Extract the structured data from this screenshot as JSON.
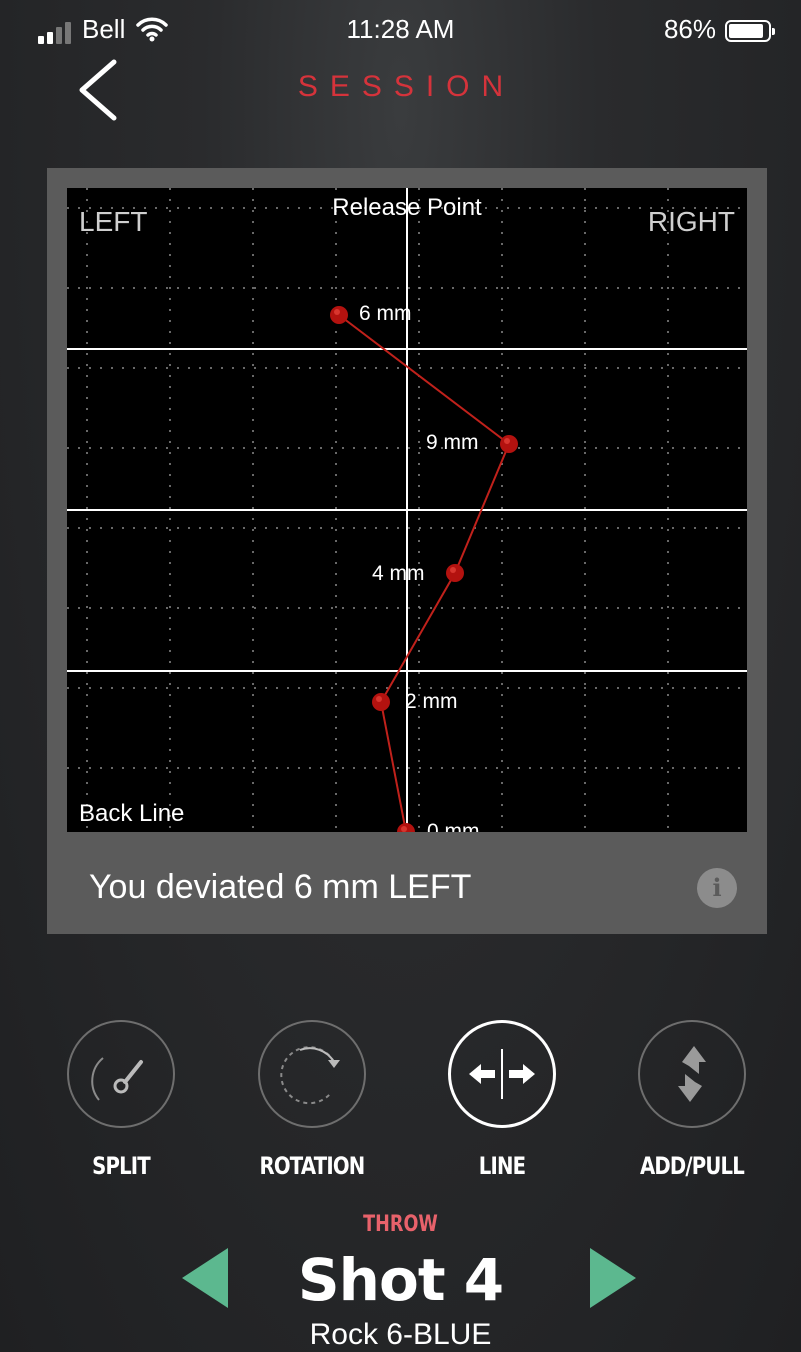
{
  "status_bar": {
    "carrier": "Bell",
    "time": "11:28 AM",
    "battery": "86%"
  },
  "header": {
    "title": "SESSION",
    "back_icon": "chevron-left-icon"
  },
  "plot": {
    "left_label": "LEFT",
    "right_label": "RIGHT",
    "top_label": "Release Point",
    "bottom_label": "Back Line",
    "points": [
      {
        "label": "6 mm"
      },
      {
        "label": "9 mm"
      },
      {
        "label": "4 mm"
      },
      {
        "label": "2 mm"
      },
      {
        "label": "0 mm"
      }
    ]
  },
  "result": {
    "text": "You deviated 6 mm LEFT",
    "info_icon": "info-icon"
  },
  "modes": [
    {
      "label": "SPLIT",
      "icon": "stopwatch-icon"
    },
    {
      "label": "ROTATION",
      "icon": "rotation-icon"
    },
    {
      "label": "LINE",
      "icon": "line-arrows-icon",
      "active": true
    },
    {
      "label": "ADD/PULL",
      "icon": "add-pull-icon"
    }
  ],
  "throw": {
    "label": "THROW",
    "shot": "Shot 4",
    "rock": "Rock 6-BLUE"
  },
  "colors": {
    "accent": "#d5333b",
    "nav_arrow": "#5cb88f",
    "point": "#b3120f"
  }
}
